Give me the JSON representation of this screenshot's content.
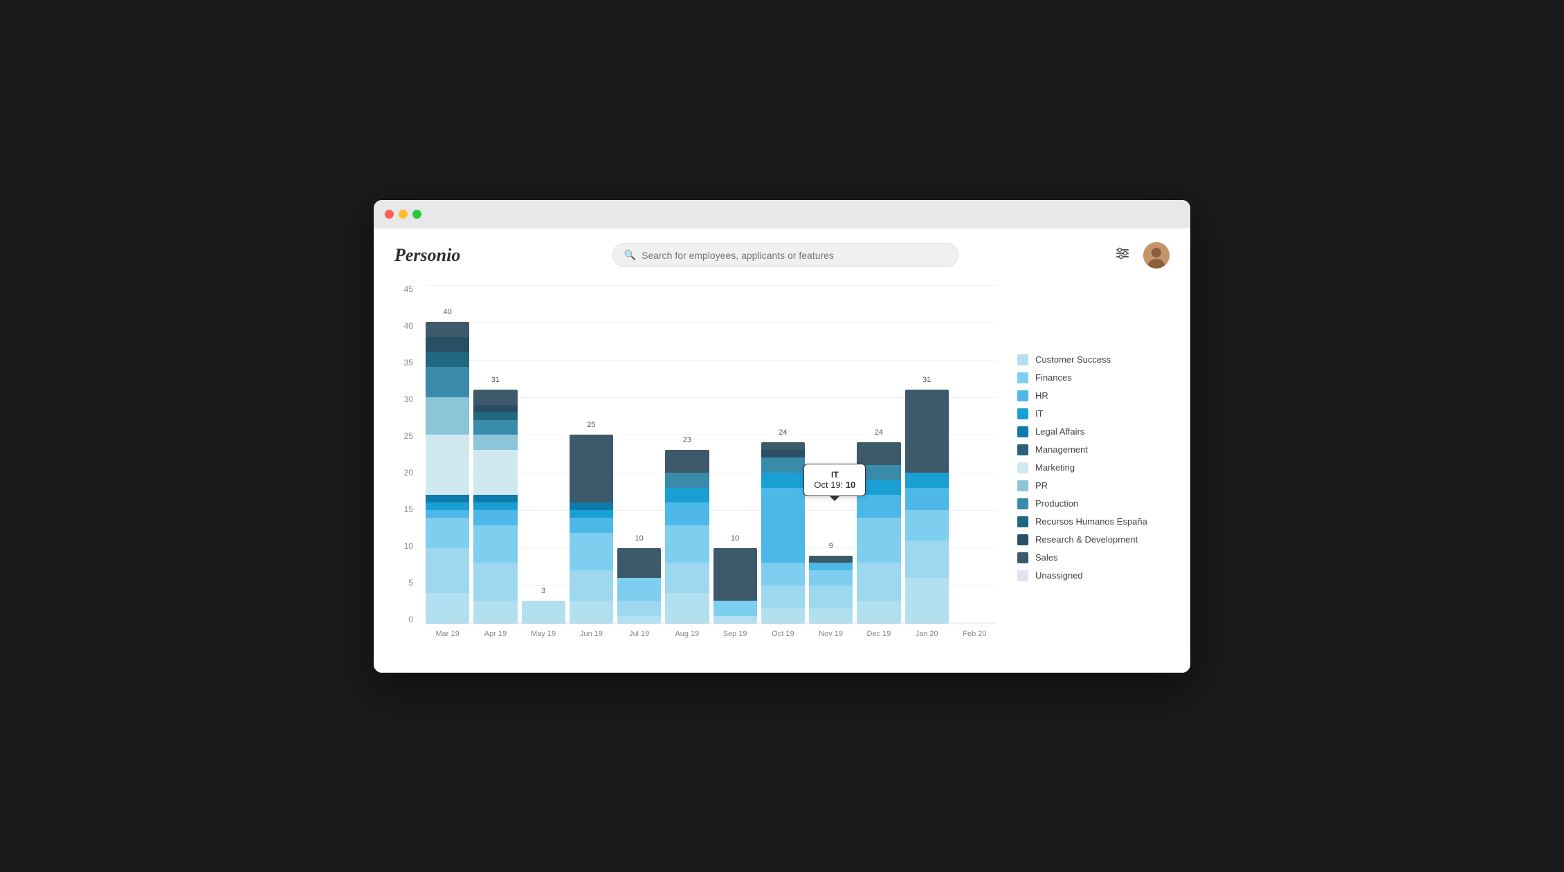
{
  "browser": {
    "traffic_lights": [
      "red",
      "yellow",
      "green"
    ]
  },
  "header": {
    "logo": "Personio",
    "search_placeholder": "Search for employees, applicants or features"
  },
  "chart": {
    "y_axis": [
      45,
      40,
      35,
      30,
      25,
      20,
      15,
      10,
      5,
      0
    ],
    "x_labels": [
      "Mar 19",
      "Apr 19",
      "May 19",
      "Jun 19",
      "Jul 19",
      "Aug 19",
      "Sep 19",
      "Oct 19",
      "Nov 19",
      "Dec 19",
      "Jan 20",
      "Feb 20"
    ],
    "totals": [
      40,
      31,
      3,
      25,
      10,
      23,
      10,
      24,
      9,
      24,
      31,
      0
    ],
    "tooltip": {
      "title": "IT",
      "date": "Oct 19",
      "value": "10"
    }
  },
  "legend": {
    "items": [
      {
        "label": "Customer Success",
        "color": "#b3e0f0"
      },
      {
        "label": "Finances",
        "color": "#7ecef0"
      },
      {
        "label": "HR",
        "color": "#4db8e8"
      },
      {
        "label": "IT",
        "color": "#1a9fd4"
      },
      {
        "label": "Legal Affairs",
        "color": "#0d7aab"
      },
      {
        "label": "Management",
        "color": "#2d5f7a"
      },
      {
        "label": "Marketing",
        "color": "#d0e8f0"
      },
      {
        "label": "PR",
        "color": "#8ac5d8"
      },
      {
        "label": "Production",
        "color": "#3a8aaa"
      },
      {
        "label": "Recursos Humanos España",
        "color": "#1f6880"
      },
      {
        "label": "Research & Development",
        "color": "#2a4f65"
      },
      {
        "label": "Sales",
        "color": "#3d5a6a"
      },
      {
        "label": "Unassigned",
        "color": "#e8e0f0"
      }
    ]
  }
}
